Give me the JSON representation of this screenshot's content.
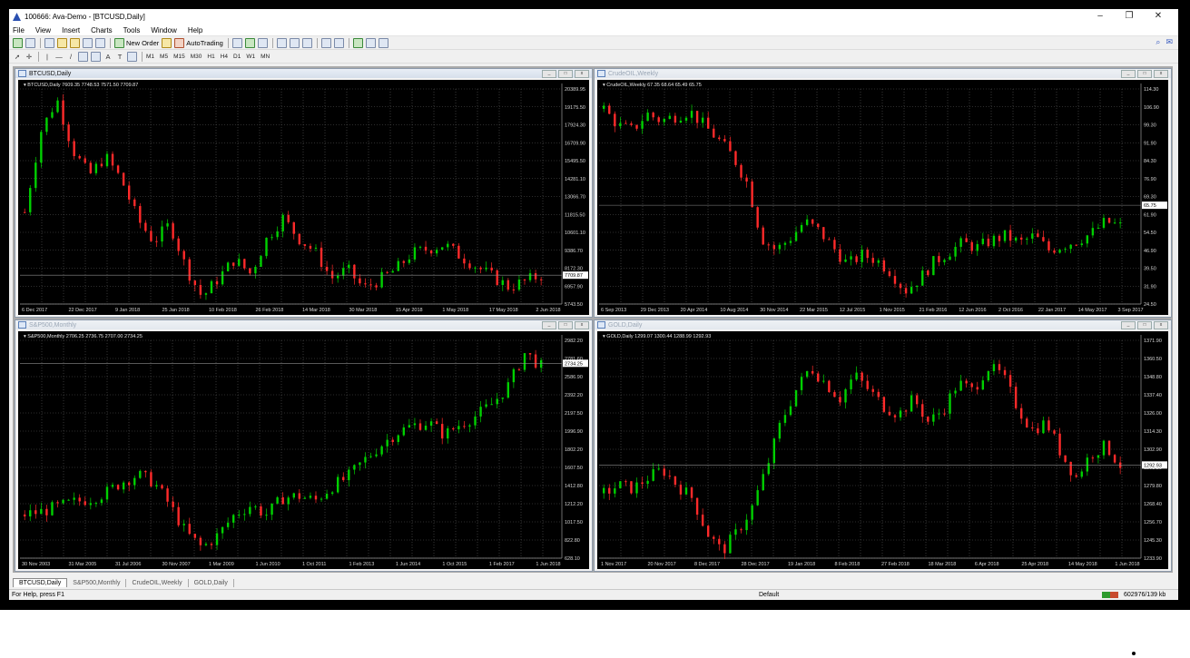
{
  "app": {
    "title": "100666: Ava-Demo - [BTCUSD,Daily]",
    "controls": {
      "minimize": "–",
      "restore": "❐",
      "close": "✕"
    }
  },
  "menu": [
    "File",
    "View",
    "Insert",
    "Charts",
    "Tools",
    "Window",
    "Help"
  ],
  "toolbar": {
    "new_order": "New Order",
    "autotrading": "AutoTrading",
    "periods": [
      "M1",
      "M5",
      "M15",
      "M30",
      "H1",
      "H4",
      "D1",
      "W1",
      "MN"
    ],
    "line_tools": {
      "text": "A",
      "label": "T"
    }
  },
  "charts": [
    {
      "window_title": "BTCUSD,Daily",
      "active": true,
      "info": "BTCUSD,Daily 7609.35 7748.53 7571.50 7709.87",
      "price_labels": [
        "20389.95",
        "19175.50",
        "17924.30",
        "16709.90",
        "15495.50",
        "14281.10",
        "13066.70",
        "11815.50",
        "10601.10",
        "9386.70",
        "8172.30",
        "6957.90",
        "5743.50"
      ],
      "current_price": "7709.87",
      "date_labels": [
        "6 Dec 2017",
        "22 Dec 2017",
        "9 Jan 2018",
        "25 Jan 2018",
        "10 Feb 2018",
        "26 Feb 2018",
        "14 Mar 2018",
        "30 Mar 2018",
        "15 Apr 2018",
        "1 May 2018",
        "17 May 2018",
        "2 Jun 2018"
      ],
      "y_range": [
        5743.5,
        20389.95
      ],
      "trend": [
        12000,
        17500,
        19700,
        16200,
        14500,
        15800,
        14200,
        11500,
        10000,
        11200,
        8200,
        6200,
        7500,
        8800,
        7800,
        10200,
        11600,
        10200,
        9300,
        7500,
        8100,
        6800,
        7400,
        8100,
        9200,
        9500,
        9800,
        9000,
        8300,
        7600,
        6900,
        7300,
        7709.87
      ],
      "colors": {
        "up": "#00d000",
        "down": "#ff2a2a"
      }
    },
    {
      "window_title": "CrudeOIL,Weekly",
      "active": false,
      "info": "CrudeOIL,Weekly 67.35 68.64 65.49 65.75",
      "price_labels": [
        "114.30",
        "106.90",
        "99.30",
        "91.90",
        "84.30",
        "76.90",
        "69.30",
        "61.90",
        "54.50",
        "46.90",
        "39.50",
        "31.90",
        "24.50"
      ],
      "current_price": "65.75",
      "date_labels": [
        "6 Sep 2013",
        "29 Dec 2013",
        "20 Apr 2014",
        "10 Aug 2014",
        "30 Nov 2014",
        "22 Mar 2015",
        "12 Jul 2015",
        "1 Nov 2015",
        "21 Feb 2016",
        "12 Jun 2016",
        "2 Oct 2016",
        "22 Jan 2017",
        "14 May 2017",
        "3 Sep 2017"
      ],
      "y_range": [
        24.5,
        114.3
      ],
      "trend": [
        106,
        99,
        97,
        104,
        101,
        103,
        105,
        99,
        93,
        86,
        75,
        52,
        47,
        52,
        59,
        55,
        48,
        41,
        45,
        43,
        38,
        30,
        35,
        42,
        46,
        50,
        48,
        51,
        53,
        50,
        53,
        47,
        49,
        51,
        54,
        59,
        57
      ],
      "colors": {
        "up": "#00d000",
        "down": "#ff2a2a"
      }
    },
    {
      "window_title": "S&P500,Monthly",
      "active": false,
      "info": "S&P500,Monthly 2706.25 2736.75 2707.00 2734.25",
      "price_labels": [
        "2982.20",
        "2781.60",
        "2586.90",
        "2392.20",
        "2197.50",
        "1996.90",
        "1802.20",
        "1607.50",
        "1412.80",
        "1212.20",
        "1017.50",
        "822.80",
        "628.10"
      ],
      "current_price": "2734.25",
      "date_labels": [
        "30 Nov 2003",
        "31 Mar 2005",
        "31 Jul 2006",
        "30 Nov 2007",
        "1 Mar 2009",
        "1 Jun 2010",
        "1 Oct 2011",
        "1 Feb 2013",
        "1 Jun 2014",
        "1 Oct 2015",
        "1 Feb 2017",
        "1 Jun 2018"
      ],
      "y_range": [
        628.1,
        2982.2
      ],
      "trend": [
        1100,
        1130,
        1180,
        1230,
        1270,
        1330,
        1450,
        1530,
        1450,
        1200,
        900,
        740,
        880,
        1100,
        1200,
        1100,
        1280,
        1300,
        1250,
        1400,
        1500,
        1680,
        1840,
        1980,
        2060,
        2100,
        1960,
        2080,
        2170,
        2300,
        2500,
        2850,
        2700
      ],
      "colors": {
        "up": "#00d000",
        "down": "#ff2a2a"
      }
    },
    {
      "window_title": "GOLD,Daily",
      "active": false,
      "info": "GOLD,Daily 1299.07 1300.44 1288.99 1292.93",
      "price_labels": [
        "1371.90",
        "1360.50",
        "1348.80",
        "1337.40",
        "1326.00",
        "1314.30",
        "1302.90",
        "1291.20",
        "1279.80",
        "1268.40",
        "1256.70",
        "1245.30",
        "1233.90"
      ],
      "current_price": "1292.93",
      "date_labels": [
        "1 Nov 2017",
        "20 Nov 2017",
        "8 Dec 2017",
        "28 Dec 2017",
        "19 Jan 2018",
        "8 Feb 2018",
        "27 Feb 2018",
        "18 Mar 2018",
        "6 Apr 2018",
        "25 Apr 2018",
        "14 May 2018",
        "1 Jun 2018"
      ],
      "y_range": [
        1233.9,
        1371.9
      ],
      "trend": [
        1275,
        1280,
        1278,
        1285,
        1290,
        1280,
        1272,
        1250,
        1238,
        1250,
        1265,
        1290,
        1320,
        1340,
        1355,
        1345,
        1335,
        1350,
        1340,
        1330,
        1325,
        1335,
        1320,
        1328,
        1345,
        1340,
        1355,
        1350,
        1330,
        1315,
        1320,
        1300,
        1285,
        1300,
        1305,
        1292.93
      ],
      "colors": {
        "up": "#00d000",
        "down": "#ff2a2a"
      }
    }
  ],
  "tabs": [
    {
      "label": "BTCUSD,Daily",
      "active": true
    },
    {
      "label": "S&P500,Monthly",
      "active": false
    },
    {
      "label": "CrudeOIL,Weekly",
      "active": false
    },
    {
      "label": "GOLD,Daily",
      "active": false
    }
  ],
  "status": {
    "help": "For Help, press F1",
    "profile": "Default",
    "traffic": "602976/139 kb"
  }
}
